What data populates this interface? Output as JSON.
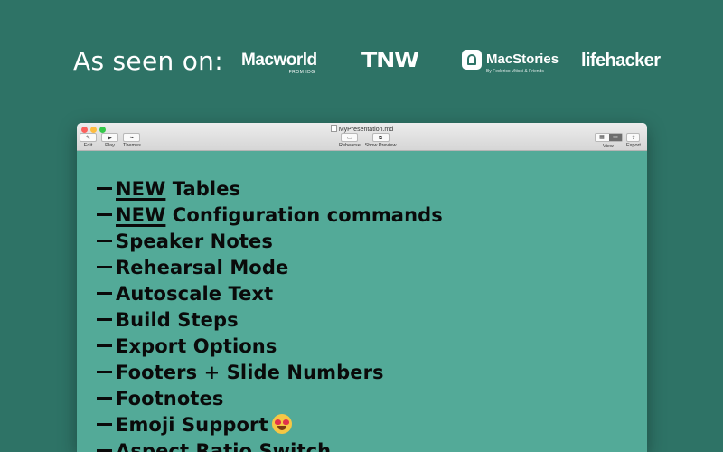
{
  "hero": {
    "seen_label": "As seen on:",
    "logos": {
      "macworld": {
        "name": "Macworld",
        "sub": "FROM IDG"
      },
      "tnw": {
        "name": "TNW"
      },
      "macstories": {
        "name": "MacStories",
        "sub": "By Federico Viticci & Friends"
      },
      "lifehacker": {
        "name": "lifehacker"
      }
    }
  },
  "window": {
    "title": "MyPresentation.md",
    "toolbar": {
      "edit": "Edit",
      "play": "Play",
      "themes": "Themes",
      "rehearse": "Rehearse",
      "show_preview": "Show Preview",
      "view": "View",
      "export": "Export"
    }
  },
  "slide": {
    "items": [
      {
        "prefix": "NEW",
        "text": " Tables"
      },
      {
        "prefix": "NEW",
        "text": " Configuration commands"
      },
      {
        "text": "Speaker Notes"
      },
      {
        "text": "Rehearsal Mode"
      },
      {
        "text": "Autoscale Text"
      },
      {
        "text": "Build Steps"
      },
      {
        "text": "Export Options"
      },
      {
        "text": "Footers + Slide Numbers"
      },
      {
        "text": "Footnotes"
      },
      {
        "text": "Emoji Support"
      },
      {
        "text": "Aspect Ratio Switch"
      }
    ]
  },
  "colors": {
    "background": "#2e7366",
    "slide_background": "#53aa98",
    "text": "#0a0a0a"
  }
}
